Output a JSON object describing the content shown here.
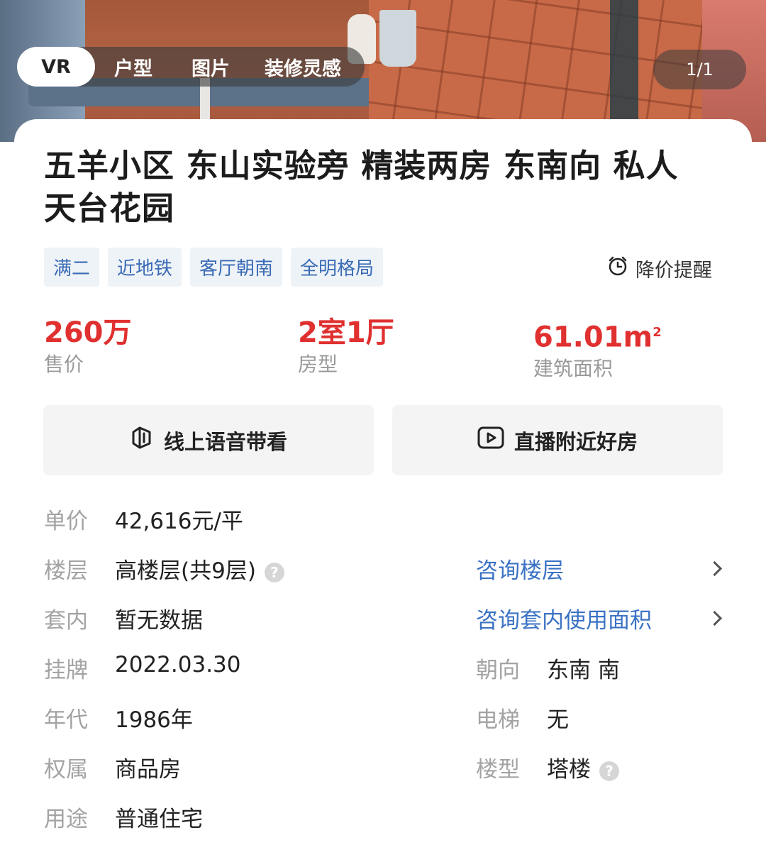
{
  "gallery": {
    "tabs": [
      {
        "label": "VR",
        "active": true
      },
      {
        "label": "户型",
        "active": false
      },
      {
        "label": "图片",
        "active": false
      },
      {
        "label": "装修灵感",
        "active": false
      }
    ],
    "counter": "1/1"
  },
  "listing": {
    "title": "五羊小区 东山实验旁 精装两房 东南向 私人天台花园",
    "tags": [
      "满二",
      "近地铁",
      "客厅朝南",
      "全明格局"
    ],
    "price_alert": "降价提醒"
  },
  "stats": {
    "price": {
      "value": "260万",
      "label": "售价"
    },
    "layout": {
      "value": "2室1厅",
      "label": "房型"
    },
    "area": {
      "value": "61.01m",
      "sup": "2",
      "label": "建筑面积"
    }
  },
  "actions": {
    "voice_tour": "线上语音带看",
    "live_stream": "直播附近好房"
  },
  "details": {
    "unit_price": {
      "label": "单价",
      "value": "42,616元/平"
    },
    "floor": {
      "label": "楼层",
      "value": "高楼层(共9层)",
      "link": "咨询楼层"
    },
    "inner_area": {
      "label": "套内",
      "value": "暂无数据",
      "link": "咨询套内使用面积"
    },
    "listed": {
      "label": "挂牌",
      "value": "2022.03.30"
    },
    "orientation": {
      "label": "朝向",
      "value": "东南 南"
    },
    "year": {
      "label": "年代",
      "value": "1986年"
    },
    "elevator": {
      "label": "电梯",
      "value": "无"
    },
    "ownership": {
      "label": "权属",
      "value": "商品房"
    },
    "building_type": {
      "label": "楼型",
      "value": "塔楼"
    },
    "usage": {
      "label": "用途",
      "value": "普通住宅"
    }
  },
  "colors": {
    "price_red": "#e03030",
    "link_blue": "#3b72c4",
    "tag_bg": "#eef3f8"
  }
}
